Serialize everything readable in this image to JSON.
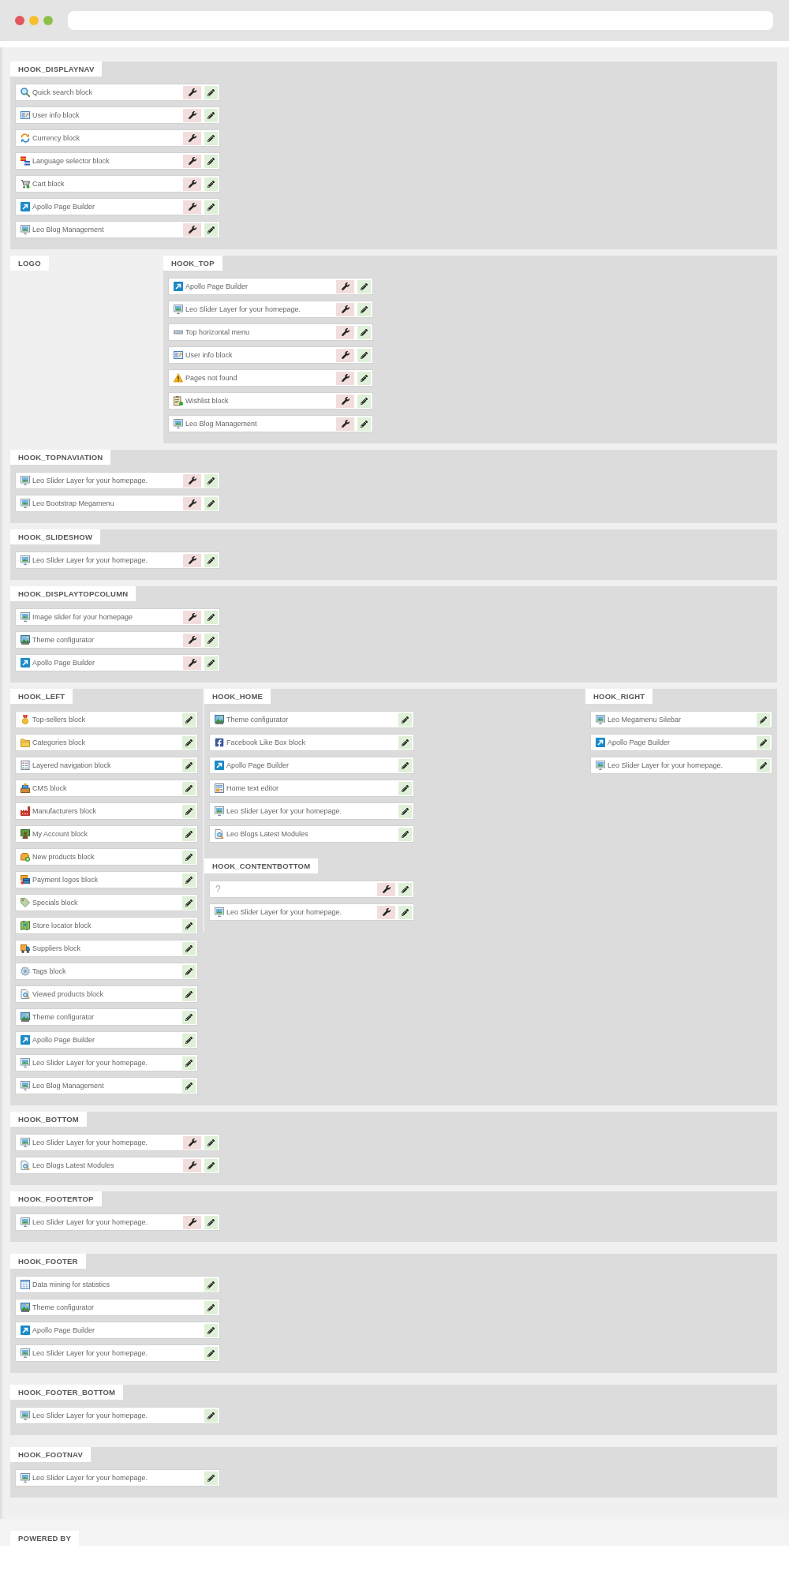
{
  "main": [
    {
      "columns": [
        {
          "hooks": [
            {
              "title": "HOOK_DISPLAYNAV",
              "modules": [
                {
                  "kind": "search",
                  "name": "Quick search block",
                  "configurable": true
                },
                {
                  "kind": "user",
                  "name": "User info block",
                  "configurable": true
                },
                {
                  "kind": "currency",
                  "name": "Currency block",
                  "configurable": true
                },
                {
                  "kind": "language",
                  "name": "Language selector block",
                  "configurable": true
                },
                {
                  "kind": "cart",
                  "name": "Cart block",
                  "configurable": true
                },
                {
                  "kind": "builder",
                  "name": "Apollo Page Builder",
                  "configurable": true
                },
                {
                  "kind": "slider",
                  "name": "Leo Blog Management",
                  "configurable": true
                }
              ]
            }
          ]
        }
      ]
    },
    {
      "columns": [
        {
          "hooks": [
            {
              "title": "LOGO"
            }
          ]
        },
        {
          "hooks": [
            {
              "title": "HOOK_TOP",
              "modules": [
                {
                  "kind": "builder",
                  "name": "Apollo Page Builder",
                  "configurable": true
                },
                {
                  "kind": "slider",
                  "name": "Leo Slider Layer for your homepage.",
                  "configurable": true
                },
                {
                  "kind": "menu",
                  "name": "Top horizontal menu",
                  "configurable": true
                },
                {
                  "kind": "user",
                  "name": "User info block",
                  "configurable": true
                },
                {
                  "kind": "error",
                  "name": "Pages not found",
                  "configurable": true
                },
                {
                  "kind": "wishlist",
                  "name": "Wishlist block",
                  "configurable": true
                },
                {
                  "kind": "slider",
                  "name": "Leo Blog Management",
                  "configurable": true
                }
              ]
            }
          ]
        }
      ]
    },
    {
      "columns": [
        {
          "hooks": [
            {
              "title": "HOOK_TOPNAVIATION",
              "modules": [
                {
                  "kind": "slider",
                  "name": "Leo Slider Layer for your homepage.",
                  "configurable": true
                },
                {
                  "kind": "slider",
                  "name": "Leo Bootstrap Megamenu",
                  "configurable": true
                }
              ]
            }
          ]
        }
      ]
    },
    {
      "columns": [
        {
          "hooks": [
            {
              "title": "HOOK_SLIDESHOW",
              "modules": [
                {
                  "kind": "slider",
                  "name": "Leo Slider Layer for your homepage.",
                  "configurable": true
                }
              ]
            }
          ]
        }
      ]
    },
    {
      "columns": [
        {
          "hooks": [
            {
              "title": "HOOK_DISPLAYTOPCOLUMN",
              "modules": [
                {
                  "kind": "slider",
                  "name": "Image slider for your homepage",
                  "configurable": true
                },
                {
                  "kind": "theme",
                  "name": "Theme configurator",
                  "configurable": true
                },
                {
                  "kind": "builder",
                  "name": "Apollo Page Builder",
                  "configurable": true
                }
              ]
            }
          ]
        }
      ]
    },
    {
      "columns": [
        {
          "hooks": [
            {
              "title": "HOOK_LEFT",
              "modules": [
                {
                  "kind": "bestsellers",
                  "name": "Top-sellers block",
                  "configurable": false
                },
                {
                  "kind": "categories",
                  "name": "Categories block",
                  "configurable": false
                },
                {
                  "kind": "layered",
                  "name": "Layered navigation block",
                  "configurable": false
                },
                {
                  "kind": "cms",
                  "name": "CMS block",
                  "configurable": false
                },
                {
                  "kind": "manufacturers",
                  "name": "Manufacturers block",
                  "configurable": false
                },
                {
                  "kind": "account",
                  "name": "My Account block",
                  "configurable": false
                },
                {
                  "kind": "new",
                  "name": "New products block",
                  "configurable": false
                },
                {
                  "kind": "payment",
                  "name": "Payment logos block",
                  "configurable": false
                },
                {
                  "kind": "specials",
                  "name": "Specials block",
                  "configurable": false
                },
                {
                  "kind": "stores",
                  "name": "Store locator block",
                  "configurable": false
                },
                {
                  "kind": "suppliers",
                  "name": "Suppliers block",
                  "configurable": false
                },
                {
                  "kind": "tags",
                  "name": "Tags block",
                  "configurable": false
                },
                {
                  "kind": "viewed",
                  "name": "Viewed products block",
                  "configurable": false
                },
                {
                  "kind": "theme",
                  "name": "Theme configurator",
                  "configurable": false
                },
                {
                  "kind": "builder",
                  "name": "Apollo Page Builder",
                  "configurable": false
                },
                {
                  "kind": "slider",
                  "name": "Leo Slider Layer for your homepage.",
                  "configurable": false
                },
                {
                  "kind": "slider",
                  "name": "Leo Blog Management",
                  "configurable": false
                }
              ]
            }
          ]
        },
        {
          "hooks": [
            {
              "title": "HOOK_HOME",
              "modules": [
                {
                  "kind": "theme",
                  "name": "Theme configurator",
                  "configurable": false
                },
                {
                  "kind": "facebook",
                  "name": "Facebook Like Box block",
                  "configurable": false
                },
                {
                  "kind": "builder",
                  "name": "Apollo Page Builder",
                  "configurable": false
                },
                {
                  "kind": "editor",
                  "name": "Home text editor",
                  "configurable": false
                },
                {
                  "kind": "slider",
                  "name": "Leo Slider Layer for your homepage.",
                  "configurable": false
                },
                {
                  "kind": "blog",
                  "name": "Leo Blogs Latest Modules",
                  "configurable": false
                }
              ]
            },
            {
              "title": "HOOK_CONTENTBOTTOM",
              "modules": [
                {
                  "kind": "unknown",
                  "name": "?",
                  "configurable": true
                },
                {
                  "kind": "slider",
                  "name": "Leo Slider Layer for your homepage.",
                  "configurable": true
                }
              ]
            }
          ]
        },
        {
          "hooks": [
            {
              "title": "HOOK_RIGHT",
              "modules": [
                {
                  "kind": "slider",
                  "name": "Leo Megamenu Silebar",
                  "configurable": false
                },
                {
                  "kind": "builder",
                  "name": "Apollo Page Builder",
                  "configurable": false
                },
                {
                  "kind": "slider",
                  "name": "Leo Slider Layer for your homepage.",
                  "configurable": false
                }
              ]
            }
          ]
        }
      ]
    },
    {
      "columns": [
        {
          "hooks": [
            {
              "title": "HOOK_BOTTOM",
              "modules": [
                {
                  "kind": "slider",
                  "name": "Leo Slider Layer for your homepage.",
                  "configurable": true
                },
                {
                  "kind": "blog",
                  "name": "Leo Blogs Latest Modules",
                  "configurable": true
                }
              ]
            }
          ]
        }
      ]
    },
    {
      "columns": [
        {
          "hooks": [
            {
              "title": "HOOK_FOOTERTOP",
              "modules": [
                {
                  "kind": "slider",
                  "name": "Leo Slider Layer for your homepage.",
                  "configurable": true
                }
              ]
            }
          ]
        }
      ]
    }
  ],
  "footer": [
    {
      "columns": [
        {
          "hooks": [
            {
              "title": "HOOK_FOOTER",
              "modules": [
                {
                  "kind": "stats",
                  "name": "Data mining for statistics",
                  "configurable": false
                },
                {
                  "kind": "theme",
                  "name": "Theme configurator",
                  "configurable": false
                },
                {
                  "kind": "builder",
                  "name": "Apollo Page Builder",
                  "configurable": false
                },
                {
                  "kind": "slider",
                  "name": "Leo Slider Layer for your homepage.",
                  "configurable": false
                }
              ]
            }
          ]
        }
      ]
    },
    {
      "columns": [
        {
          "hooks": [
            {
              "title": "HOOK_FOOTER_BOTTOM",
              "modules": [
                {
                  "kind": "slider",
                  "name": "Leo Slider Layer for your homepage.",
                  "configurable": false
                }
              ]
            }
          ]
        }
      ]
    },
    {
      "columns": [
        {
          "hooks": [
            {
              "title": "HOOK_FOOTNAV",
              "modules": [
                {
                  "kind": "slider",
                  "name": "Leo Slider Layer for your homepage.",
                  "configurable": false
                }
              ]
            }
          ]
        }
      ]
    }
  ],
  "powered_by": {
    "title": "POWERED BY"
  }
}
